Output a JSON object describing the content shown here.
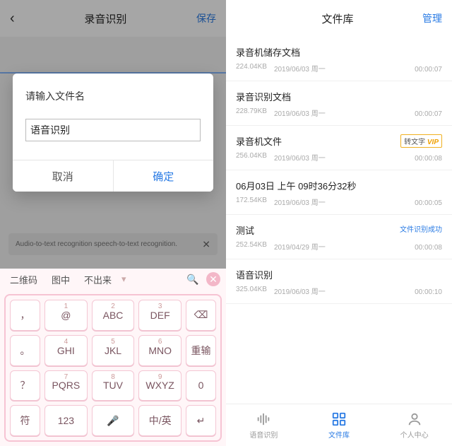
{
  "left": {
    "nav_title": "录音识别",
    "nav_save": "保存",
    "dialog": {
      "title": "请输入文件名",
      "value": "语音识别",
      "cancel": "取消",
      "confirm": "确定"
    },
    "hint_text": "Audio-to-text recognition speech-to-text recognition.",
    "ime": {
      "candidates": [
        "二维码",
        "图中",
        "不出来"
      ],
      "rows": [
        [
          {
            "n": "",
            "label": "，",
            "w": "narrow"
          },
          {
            "n": "1",
            "label": "@"
          },
          {
            "n": "2",
            "label": "ABC"
          },
          {
            "n": "3",
            "label": "DEF"
          },
          {
            "n": "",
            "label": "⌫",
            "w": "narrow"
          }
        ],
        [
          {
            "n": "",
            "label": "。",
            "w": "narrow"
          },
          {
            "n": "4",
            "label": "GHI"
          },
          {
            "n": "5",
            "label": "JKL"
          },
          {
            "n": "6",
            "label": "MNO"
          },
          {
            "n": "",
            "label": "重输",
            "w": "narrow"
          }
        ],
        [
          {
            "n": "",
            "label": "？",
            "w": "narrow"
          },
          {
            "n": "7",
            "label": "PQRS"
          },
          {
            "n": "8",
            "label": "TUV"
          },
          {
            "n": "9",
            "label": "WXYZ"
          },
          {
            "n": "",
            "label": "0",
            "w": "narrow"
          }
        ],
        [
          {
            "n": "",
            "label": "符",
            "w": "narrow"
          },
          {
            "n": "",
            "label": "123"
          },
          {
            "n": "",
            "label": "🎤"
          },
          {
            "n": "",
            "label": "中/英"
          },
          {
            "n": "",
            "label": "↵",
            "w": "narrow"
          }
        ]
      ]
    }
  },
  "right": {
    "nav_title": "文件库",
    "nav_manage": "管理",
    "files": [
      {
        "name": "录音机储存文档",
        "size": "224.04KB",
        "date": "2019/06/03",
        "day": "周一",
        "dur": "00:00:07"
      },
      {
        "name": "录音识别文档",
        "size": "228.79KB",
        "date": "2019/06/03",
        "day": "周一",
        "dur": "00:00:07"
      },
      {
        "name": "录音机文件",
        "size": "256.04KB",
        "date": "2019/06/03",
        "day": "周一",
        "dur": "00:00:08",
        "badge": "vip",
        "badge_text": "转文字"
      },
      {
        "name": "06月03日 上午 09时36分32秒",
        "size": "172.54KB",
        "date": "2019/06/03",
        "day": "周一",
        "dur": "00:00:05"
      },
      {
        "name": "测试",
        "size": "252.54KB",
        "date": "2019/04/29",
        "day": "周一",
        "dur": "00:00:08",
        "badge": "success",
        "badge_text": "文件识别成功"
      },
      {
        "name": "语音识别",
        "size": "325.04KB",
        "date": "2019/06/03",
        "day": "周一",
        "dur": "00:00:10"
      }
    ],
    "tabs": [
      {
        "label": "语音识别"
      },
      {
        "label": "文件库"
      },
      {
        "label": "个人中心"
      }
    ]
  }
}
